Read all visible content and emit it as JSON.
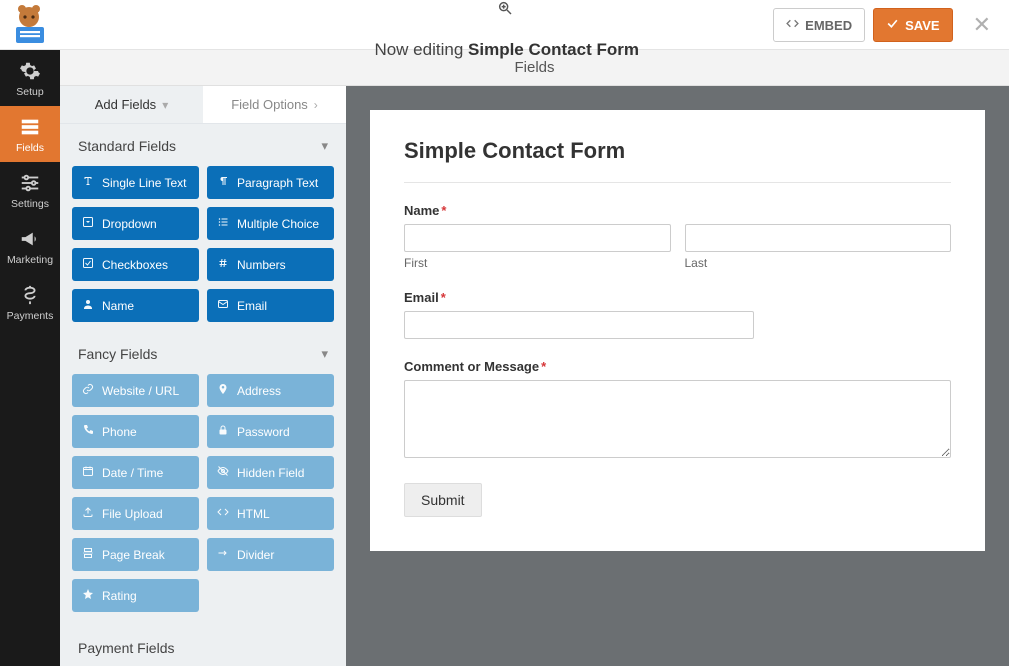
{
  "header": {
    "editing_prefix": "Now editing ",
    "form_name": "Simple Contact Form",
    "embed_label": "EMBED",
    "save_label": "SAVE"
  },
  "section_bar": {
    "title": "Fields"
  },
  "rail": {
    "items": [
      {
        "id": "setup",
        "label": "Setup"
      },
      {
        "id": "fields",
        "label": "Fields"
      },
      {
        "id": "settings",
        "label": "Settings"
      },
      {
        "id": "marketing",
        "label": "Marketing"
      },
      {
        "id": "payments",
        "label": "Payments"
      }
    ]
  },
  "side_tabs": {
    "add_fields": "Add Fields",
    "field_options": "Field Options"
  },
  "groups": {
    "standard": {
      "title": "Standard Fields",
      "items": [
        {
          "label": "Single Line Text",
          "icon": "text-tool-icon"
        },
        {
          "label": "Paragraph Text",
          "icon": "paragraph-icon"
        },
        {
          "label": "Dropdown",
          "icon": "caret-square-icon"
        },
        {
          "label": "Multiple Choice",
          "icon": "list-icon"
        },
        {
          "label": "Checkboxes",
          "icon": "check-square-icon"
        },
        {
          "label": "Numbers",
          "icon": "hash-icon"
        },
        {
          "label": "Name",
          "icon": "user-icon"
        },
        {
          "label": "Email",
          "icon": "envelope-icon"
        }
      ]
    },
    "fancy": {
      "title": "Fancy Fields",
      "items": [
        {
          "label": "Website / URL",
          "icon": "link-icon"
        },
        {
          "label": "Address",
          "icon": "map-pin-icon"
        },
        {
          "label": "Phone",
          "icon": "phone-icon"
        },
        {
          "label": "Password",
          "icon": "lock-icon"
        },
        {
          "label": "Date / Time",
          "icon": "calendar-icon"
        },
        {
          "label": "Hidden Field",
          "icon": "eye-slash-icon"
        },
        {
          "label": "File Upload",
          "icon": "upload-icon"
        },
        {
          "label": "HTML",
          "icon": "code-icon"
        },
        {
          "label": "Page Break",
          "icon": "page-break-icon"
        },
        {
          "label": "Divider",
          "icon": "divider-icon"
        },
        {
          "label": "Rating",
          "icon": "star-icon"
        }
      ]
    },
    "peek": {
      "title": "Payment Fields"
    }
  },
  "form": {
    "title": "Simple Contact Form",
    "name_label": "Name",
    "first_sub": "First",
    "last_sub": "Last",
    "email_label": "Email",
    "comment_label": "Comment or Message",
    "submit_label": "Submit"
  }
}
